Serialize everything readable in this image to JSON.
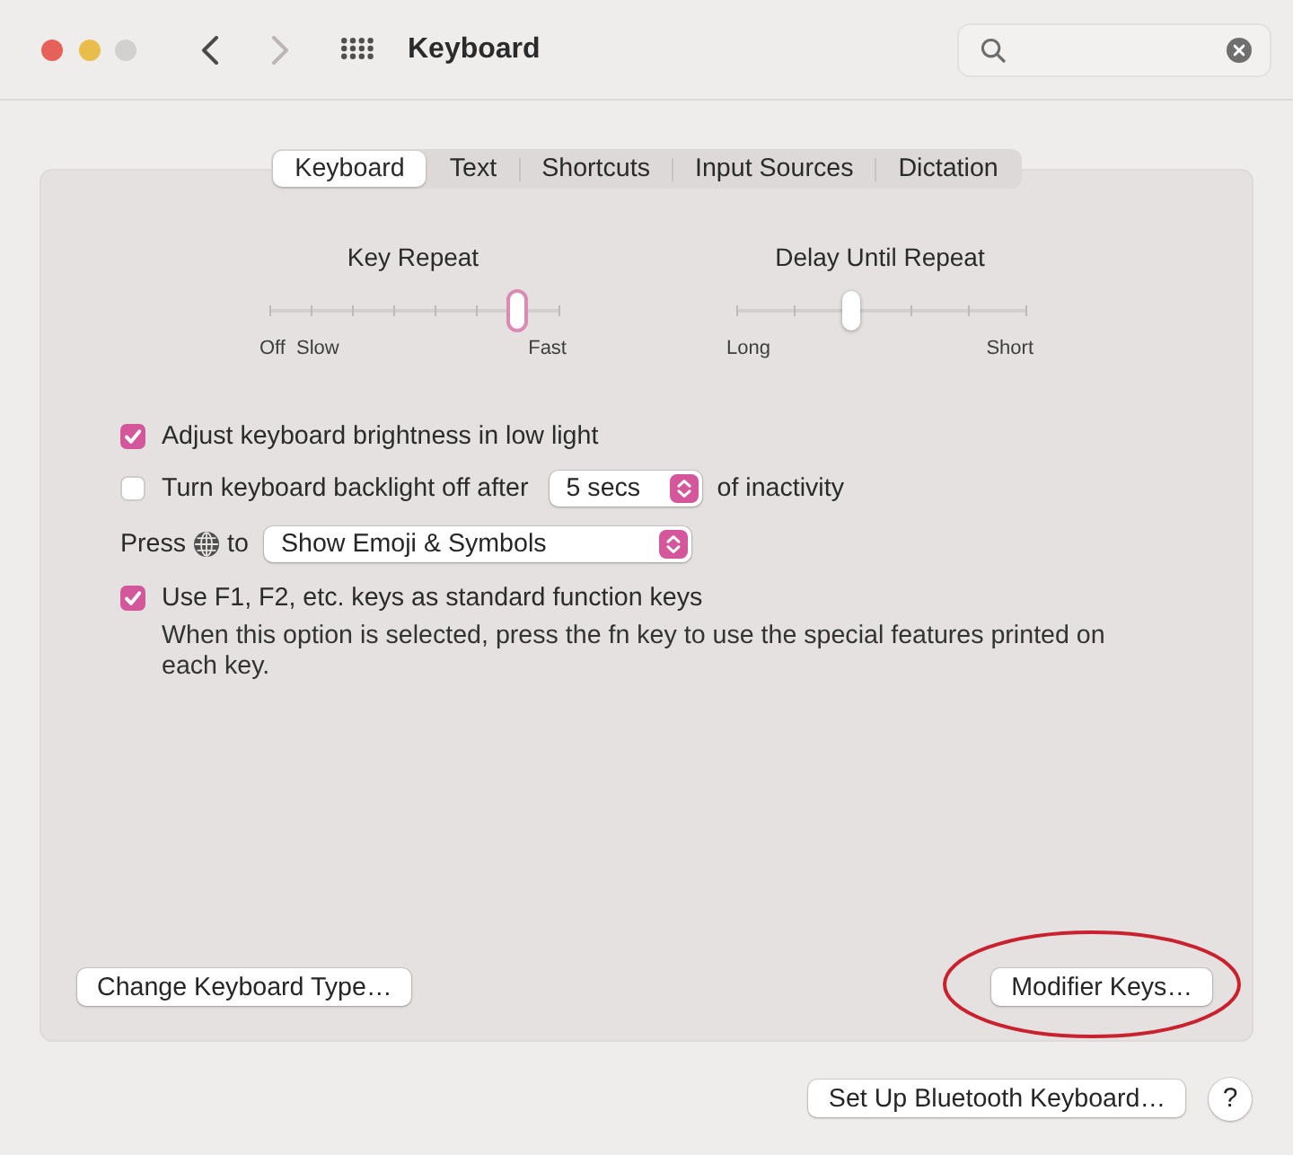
{
  "window": {
    "title": "Keyboard"
  },
  "navigation": {
    "back": {
      "disabled": false
    },
    "forward": {
      "disabled": true
    }
  },
  "tabs": [
    {
      "label": "Keyboard",
      "selected": true
    },
    {
      "label": "Text",
      "selected": false
    },
    {
      "label": "Shortcuts",
      "selected": false
    },
    {
      "label": "Input Sources",
      "selected": false
    },
    {
      "label": "Dictation",
      "selected": false
    }
  ],
  "sliders": [
    {
      "label": "Key Repeat",
      "level": 0.86,
      "focused": true,
      "start_labels": [
        "Off",
        "Slow"
      ],
      "end_labels": [
        "Fast"
      ]
    },
    {
      "label": "Delay Until Repeat",
      "level": 0.4,
      "focused": false,
      "start_labels": [
        "Long"
      ],
      "end_labels": [
        "Short"
      ]
    }
  ],
  "options": [
    {
      "kind": "checkbox",
      "label": "Adjust keyboard brightness in low light",
      "checked": true
    },
    {
      "kind": "checkbox-popup",
      "label": "Turn keyboard backlight off after",
      "checked": false,
      "popup": "5 secs",
      "suffix": "of inactivity"
    },
    {
      "kind": "popup",
      "label": "Press",
      "label_after_icon": "to",
      "popup": "Show Emoji & Symbols"
    },
    {
      "kind": "checkbox",
      "label": "Use F1, F2, etc. keys as standard function keys",
      "checked": true,
      "description": "When this option is selected, press the fn key to use the special features printed on each key."
    }
  ],
  "panel_buttons": [
    {
      "label": "Change Keyboard Type…",
      "highlighted": false
    },
    {
      "label": "Modifier Keys…",
      "highlighted": true
    }
  ],
  "footer": {
    "button": "Set Up Bluetooth Keyboard…",
    "help": "?"
  }
}
